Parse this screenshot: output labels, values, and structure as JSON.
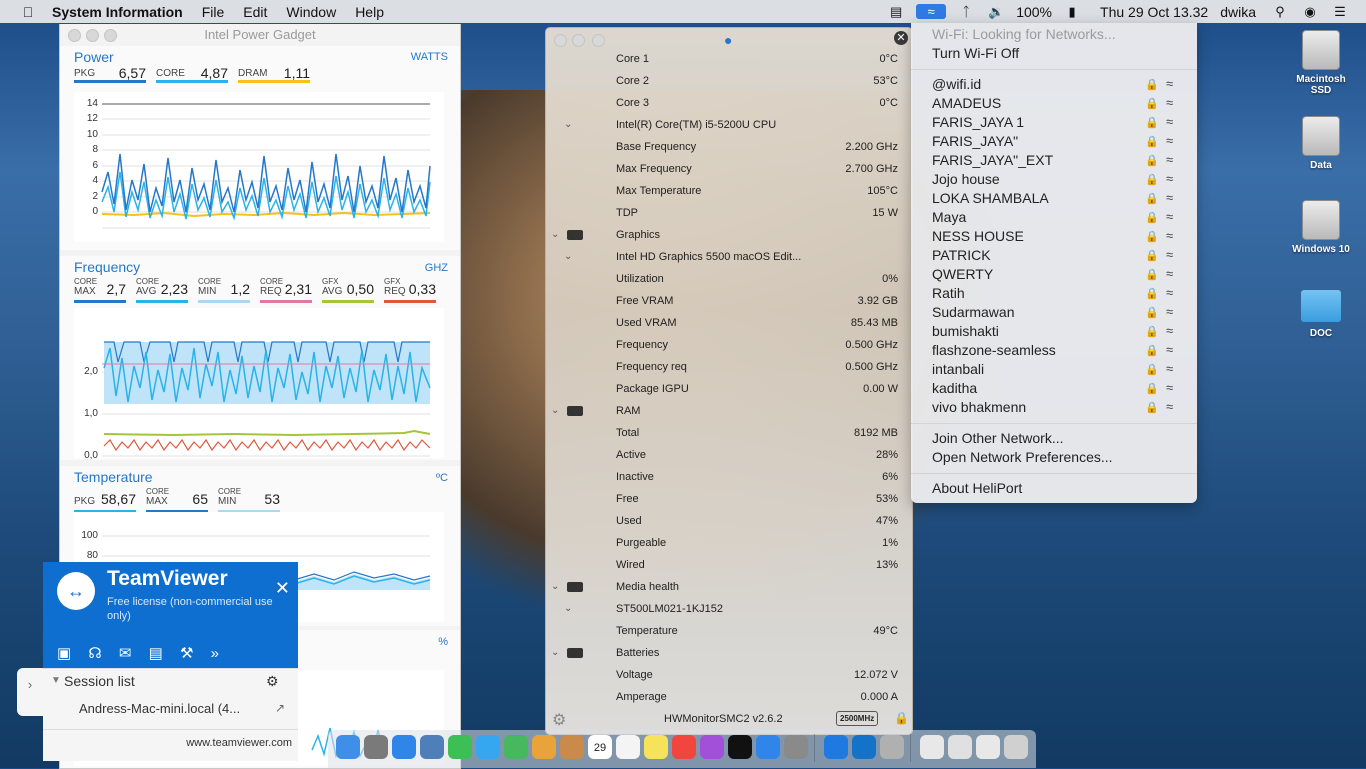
{
  "menubar": {
    "app_name": "System Information",
    "menus": [
      "File",
      "Edit",
      "Window",
      "Help"
    ],
    "battery": "100%",
    "datetime": "Thu 29 Oct  13.32",
    "user": "dwika"
  },
  "ipg": {
    "title": "Intel Power Gadget",
    "power": {
      "title": "Power",
      "unit": "WATTS",
      "metrics": [
        {
          "label": "PKG",
          "value": "6,57",
          "color": "#2677c9"
        },
        {
          "label": "CORE",
          "value": "4,87",
          "color": "#29b3e8"
        },
        {
          "label": "DRAM",
          "value": "1,11",
          "color": "#f4c21b"
        }
      ],
      "yticks": [
        "14",
        "12",
        "10",
        "8",
        "6",
        "4",
        "2",
        "0"
      ]
    },
    "frequency": {
      "title": "Frequency",
      "unit": "GHZ",
      "metrics": [
        {
          "label_top": "CORE",
          "label": "MAX",
          "value": "2,7",
          "color": "#2677c9"
        },
        {
          "label_top": "CORE",
          "label": "AVG",
          "value": "2,23",
          "color": "#29b3e8"
        },
        {
          "label_top": "CORE",
          "label": "MIN",
          "value": "1,2",
          "color": "#a9d9f5"
        },
        {
          "label_top": "CORE",
          "label": "REQ",
          "value": "2,31",
          "color": "#e07aa0"
        },
        {
          "label_top": "GFX",
          "label": "AVG",
          "value": "0,50",
          "color": "#a6c43a"
        },
        {
          "label_top": "GFX",
          "label": "REQ",
          "value": "0,33",
          "color": "#e0583a"
        }
      ],
      "yticks": [
        "2,0",
        "1,0",
        "0,0"
      ]
    },
    "temperature": {
      "title": "Temperature",
      "unit": "ºC",
      "metrics": [
        {
          "label_top": "",
          "label": "PKG",
          "value": "58,67",
          "color": "#29b3e8"
        },
        {
          "label_top": "CORE",
          "label": "MAX",
          "value": "65",
          "color": "#2677c9"
        },
        {
          "label_top": "CORE",
          "label": "MIN",
          "value": "53",
          "color": "#a9d9f5"
        }
      ],
      "yticks": [
        "100",
        "80"
      ]
    },
    "util_unit": "%"
  },
  "hwm": {
    "rows": [
      {
        "label": "Core 1",
        "value": "0°C"
      },
      {
        "label": "Core 2",
        "value": "53°C"
      },
      {
        "label": "Core 3",
        "value": "0°C"
      },
      {
        "label": "Intel(R) Core(TM) i5-5200U CPU",
        "value": "",
        "chev": "sub"
      },
      {
        "label": "Base Frequency",
        "value": "2.200 GHz"
      },
      {
        "label": "Max Frequency",
        "value": "2.700 GHz"
      },
      {
        "label": "Max Temperature",
        "value": "105°C"
      },
      {
        "label": "TDP",
        "value": "15 W"
      },
      {
        "label": "Graphics",
        "value": "",
        "chev": "group",
        "icon": "gpu"
      },
      {
        "label": "Intel HD Graphics 5500 macOS Edit...",
        "value": "",
        "chev": "sub"
      },
      {
        "label": "Utilization",
        "value": "0%"
      },
      {
        "label": "Free VRAM",
        "value": "3.92 GB"
      },
      {
        "label": "Used VRAM",
        "value": "85.43 MB"
      },
      {
        "label": "Frequency",
        "value": "0.500 GHz"
      },
      {
        "label": "Frequency req",
        "value": "0.500 GHz"
      },
      {
        "label": "Package IGPU",
        "value": "0.00 W"
      },
      {
        "label": "RAM",
        "value": "",
        "chev": "group",
        "icon": "ram"
      },
      {
        "label": "Total",
        "value": "8192 MB"
      },
      {
        "label": "Active",
        "value": "28%"
      },
      {
        "label": "Inactive",
        "value": "6%"
      },
      {
        "label": "Free",
        "value": "53%"
      },
      {
        "label": "Used",
        "value": "47%"
      },
      {
        "label": "Purgeable",
        "value": "1%"
      },
      {
        "label": "Wired",
        "value": "13%"
      },
      {
        "label": "Media health",
        "value": "",
        "chev": "group",
        "icon": "disk"
      },
      {
        "label": "ST500LM021-1KJ152",
        "value": "",
        "chev": "sub"
      },
      {
        "label": "Temperature",
        "value": "49°C"
      },
      {
        "label": "Batteries",
        "value": "",
        "chev": "group",
        "icon": "battery"
      },
      {
        "label": "Voltage",
        "value": "12.072 V"
      },
      {
        "label": "Amperage",
        "value": "0.000 A"
      }
    ],
    "footer_title": "HWMonitorSMC2 v2.6.2",
    "footer_badge": "2500MHz"
  },
  "wifi_menu": {
    "status": "Wi-Fi: Looking for Networks...",
    "toggle": "Turn Wi-Fi Off",
    "networks": [
      "@wifi.id",
      "AMADEUS",
      "FARIS_JAYA 1",
      "FARIS_JAYA\"",
      "FARIS_JAYA\"_EXT",
      "Jojo house",
      "LOKA SHAMBALA",
      "Maya",
      "NESS HOUSE",
      "PATRICK",
      "QWERTY",
      "Ratih",
      "Sudarmawan",
      "bumishakti",
      "flashzone-seamless",
      "intanbali",
      "kaditha",
      "vivo bhakmenn"
    ],
    "join_other": "Join Other Network...",
    "open_prefs": "Open Network Preferences...",
    "about": "About HeliPort"
  },
  "desktop": {
    "icons": [
      {
        "label": "Macintosh SSD",
        "type": "drive"
      },
      {
        "label": "Data",
        "type": "drive"
      },
      {
        "label": "Windows 10",
        "type": "drive"
      },
      {
        "label": "DOC",
        "type": "folder"
      }
    ]
  },
  "teamviewer": {
    "brand": "TeamViewer",
    "subtitle": "Free license (non-commercial use only)",
    "session_list": "Session list",
    "session_item": "Andress-Mac-mini.local (4...",
    "website": "www.teamviewer.com"
  },
  "dock": {
    "apps": [
      "Finder",
      "Launchpad",
      "Safari",
      "Preview",
      "FaceTime",
      "Messages",
      "Maps",
      "Photos",
      "Contacts",
      "Calendar",
      "Reminders",
      "Notes",
      "Music",
      "Podcasts",
      "TV",
      "App Store",
      "System Preferences",
      "TeamViewer",
      "Intel Power Gadget",
      "HWMonitorSMC2",
      "Documents",
      "Mail",
      "Downloads",
      "Trash"
    ],
    "calendar_day": "29"
  }
}
